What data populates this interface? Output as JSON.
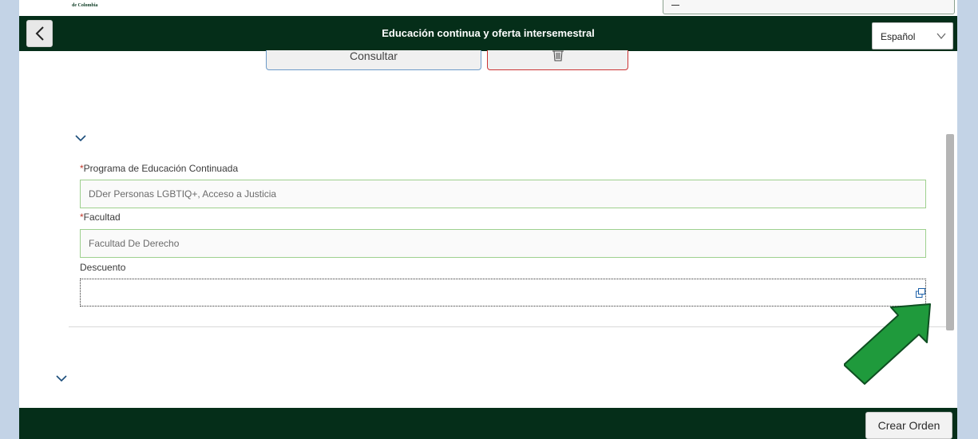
{
  "brand": {
    "text": "de Colombia"
  },
  "header": {
    "title": "Educación continua y oferta intersemestral",
    "back_icon": "chevron-left-icon",
    "language": {
      "selected": "Español",
      "icon": "chevron-down-icon"
    }
  },
  "toolbar": {
    "consultar_label": "Consultar",
    "delete_icon": "trash-icon"
  },
  "form": {
    "programa": {
      "required_mark": "*",
      "label": "Programa de Educación Continuada",
      "value": "DDer Personas LGBTIQ+, Acceso a Justicia"
    },
    "facultad": {
      "required_mark": "*",
      "label": "Facultad",
      "value": "Facultad De Derecho"
    },
    "descuento": {
      "label": "Descuento",
      "value": "",
      "value_help_icon": "value-help-icon"
    }
  },
  "footer": {
    "crear_label": "Crear Orden"
  },
  "colors": {
    "shell": "#052e19",
    "required": "#c0392b",
    "valid_border": "#9ed08e",
    "consultar_border": "#6c9ac8",
    "delete_border": "#cc3333",
    "annotation_arrow": "#1f9a3c"
  }
}
